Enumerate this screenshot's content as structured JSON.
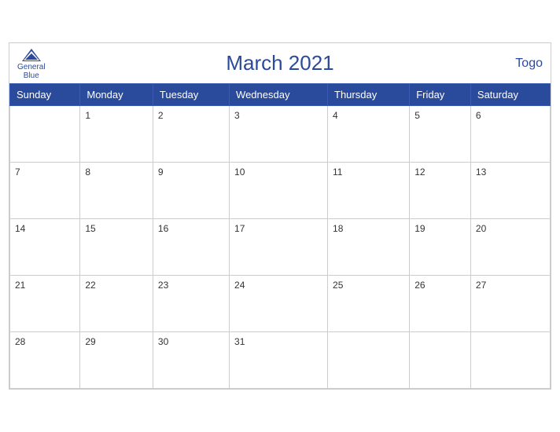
{
  "header": {
    "title": "March 2021",
    "logo_line1": "General",
    "logo_line2": "Blue",
    "country": "Togo"
  },
  "weekdays": [
    "Sunday",
    "Monday",
    "Tuesday",
    "Wednesday",
    "Thursday",
    "Friday",
    "Saturday"
  ],
  "weeks": [
    [
      null,
      1,
      2,
      3,
      4,
      5,
      6
    ],
    [
      7,
      8,
      9,
      10,
      11,
      12,
      13
    ],
    [
      14,
      15,
      16,
      17,
      18,
      19,
      20
    ],
    [
      21,
      22,
      23,
      24,
      25,
      26,
      27
    ],
    [
      28,
      29,
      30,
      31,
      null,
      null,
      null
    ]
  ]
}
